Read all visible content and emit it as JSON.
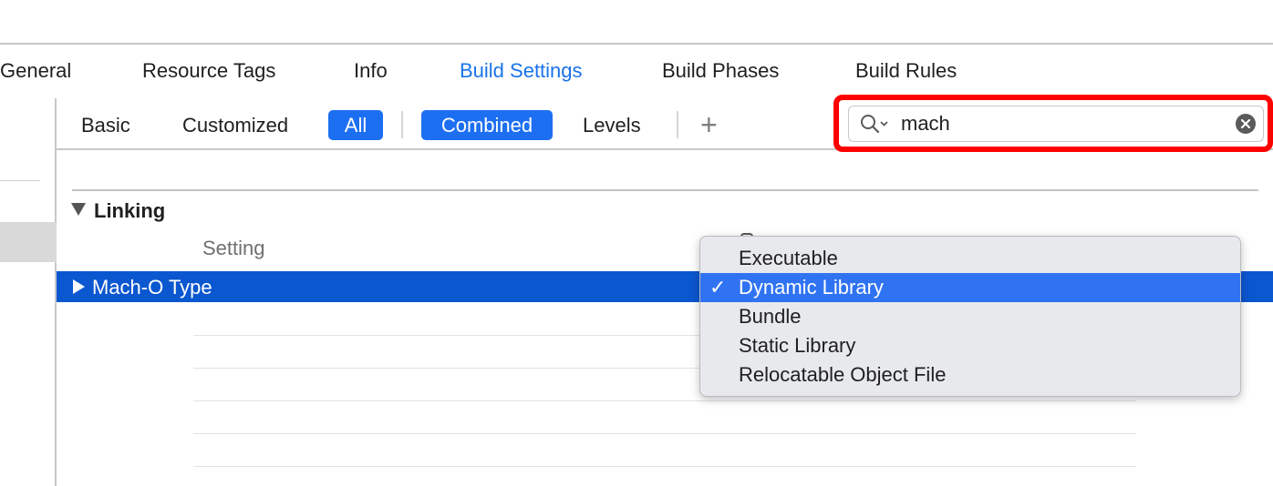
{
  "tabs": [
    {
      "label": "General"
    },
    {
      "label": "Resource Tags"
    },
    {
      "label": "Info"
    },
    {
      "label": "Build Settings",
      "active": true
    },
    {
      "label": "Build Phases"
    },
    {
      "label": "Build Rules"
    }
  ],
  "filters": {
    "basic": "Basic",
    "customized": "Customized",
    "all": "All",
    "combined": "Combined",
    "levels": "Levels",
    "add": "+"
  },
  "search": {
    "value": "mach"
  },
  "section": {
    "title": "Linking",
    "column_header": "Setting"
  },
  "row": {
    "label": "Mach-O Type"
  },
  "dropdown": {
    "check": "✓",
    "options": [
      {
        "label": "Executable"
      },
      {
        "label": "Dynamic Library",
        "selected": true
      },
      {
        "label": "Bundle"
      },
      {
        "label": "Static Library"
      },
      {
        "label": "Relocatable Object File"
      }
    ]
  },
  "colors": {
    "accent": "#1d6ff2",
    "selected_row": "#0b57d0",
    "highlight": "#ff0000"
  },
  "icons": {
    "search": "magnifier-with-chevron-icon",
    "clear": "clear-x-icon",
    "disclosure_open": "triangle-down-icon",
    "disclosure_closed": "triangle-right-icon"
  }
}
